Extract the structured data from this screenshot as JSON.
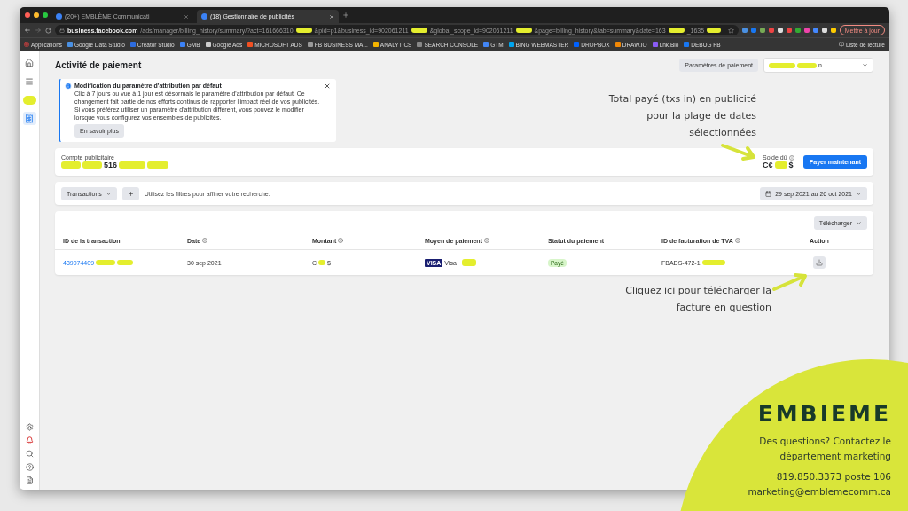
{
  "browser": {
    "tabs": [
      {
        "title": "(20+) EMBLÈME Communicati",
        "selected": false
      },
      {
        "title": "(18) Gestionnaire de publicités",
        "selected": true
      }
    ],
    "url": {
      "host": "business.facebook.com",
      "parts": [
        "/ads/manager/billing_history/summary/?act=161666310",
        "&pid=p1&business_id=902061211",
        "&global_scope_id=902061211",
        "&page=billing_history&tab=summary&date=163",
        "_1635"
      ]
    },
    "update_button": "Mettre à jour",
    "bookmarks": [
      "Applications",
      "Google Data Studio",
      "Creator Studio",
      "GMB",
      "Google Ads",
      "MICROSOFT ADS",
      "FB BUSINESS MA...",
      "ANALYTICS",
      "SEARCH CONSOLE",
      "GTM",
      "BING WEBMASTER",
      "DROPBOX",
      "DRAW.IO",
      "Lnk.Bio",
      "DEBUG FB"
    ],
    "reading_list": "Liste de lecture"
  },
  "sidebar": {
    "items": [
      {
        "kind": "home",
        "selected": false
      },
      {
        "kind": "menu",
        "selected": false
      },
      {
        "kind": "avatar",
        "selected": false
      },
      {
        "kind": "billing",
        "selected": true
      }
    ],
    "bottom": [
      {
        "kind": "settings"
      },
      {
        "kind": "bell"
      },
      {
        "kind": "search"
      },
      {
        "kind": "help"
      },
      {
        "kind": "account"
      }
    ]
  },
  "page": {
    "title": "Activité de paiement",
    "settings_button": "Paramètres de paiement",
    "account_select": "n",
    "notice": {
      "title": "Modification du paramètre d'attribution par défaut",
      "body": "Clic à 7 jours ou vue à 1 jour est désormais le paramètre d'attribution par défaut. Ce changement fait partie de nos efforts continus de rapporter l'impact réel de vos publicités. Si vous préférez utiliser un paramètre d'attribution différent, vous pouvez le modifier lorsque vous configurez vos ensembles de publicités.",
      "button": "En savoir plus"
    },
    "account": {
      "label": "Compte publicitaire",
      "value": "516",
      "balance_label": "Solde dû",
      "balance_prefix": "C€",
      "balance_suffix": "$",
      "pay_button": "Payer maintenant"
    },
    "filters": {
      "dropdown": "Transactions",
      "hint": "Utilisez les filtres pour affiner votre recherche.",
      "date_range": "29 sep 2021 au 26 oct 2021"
    },
    "table": {
      "download_button": "Télécharger",
      "columns": [
        {
          "label": "ID de la transaction",
          "info": false
        },
        {
          "label": "Date",
          "info": true
        },
        {
          "label": "Montant",
          "info": true
        },
        {
          "label": "Moyen de paiement",
          "info": true
        },
        {
          "label": "Statut du paiement",
          "info": false
        },
        {
          "label": "ID de facturation de TVA",
          "info": true
        },
        {
          "label": "Action",
          "info": false
        }
      ],
      "rows": [
        {
          "id": "439074409",
          "date": "30 sep 2021",
          "amount_prefix": "C",
          "amount_suffix": "$",
          "card_brand": "VISA",
          "card": "Visa ·",
          "status": "Payé",
          "vat_id": "FBADS-472-1"
        }
      ]
    }
  },
  "annotations": [
    {
      "text": "Total payé (txs in) en publicité pour la plage de dates sélectionnées"
    },
    {
      "text": "Cliquez ici pour télécharger la facture en question"
    }
  ],
  "brand": {
    "logo": "EMBIEME",
    "question": "Des questions? Contactez le département marketing",
    "phone": "819.850.3373 poste 106",
    "email": "marketing@emblemecomm.ca"
  }
}
